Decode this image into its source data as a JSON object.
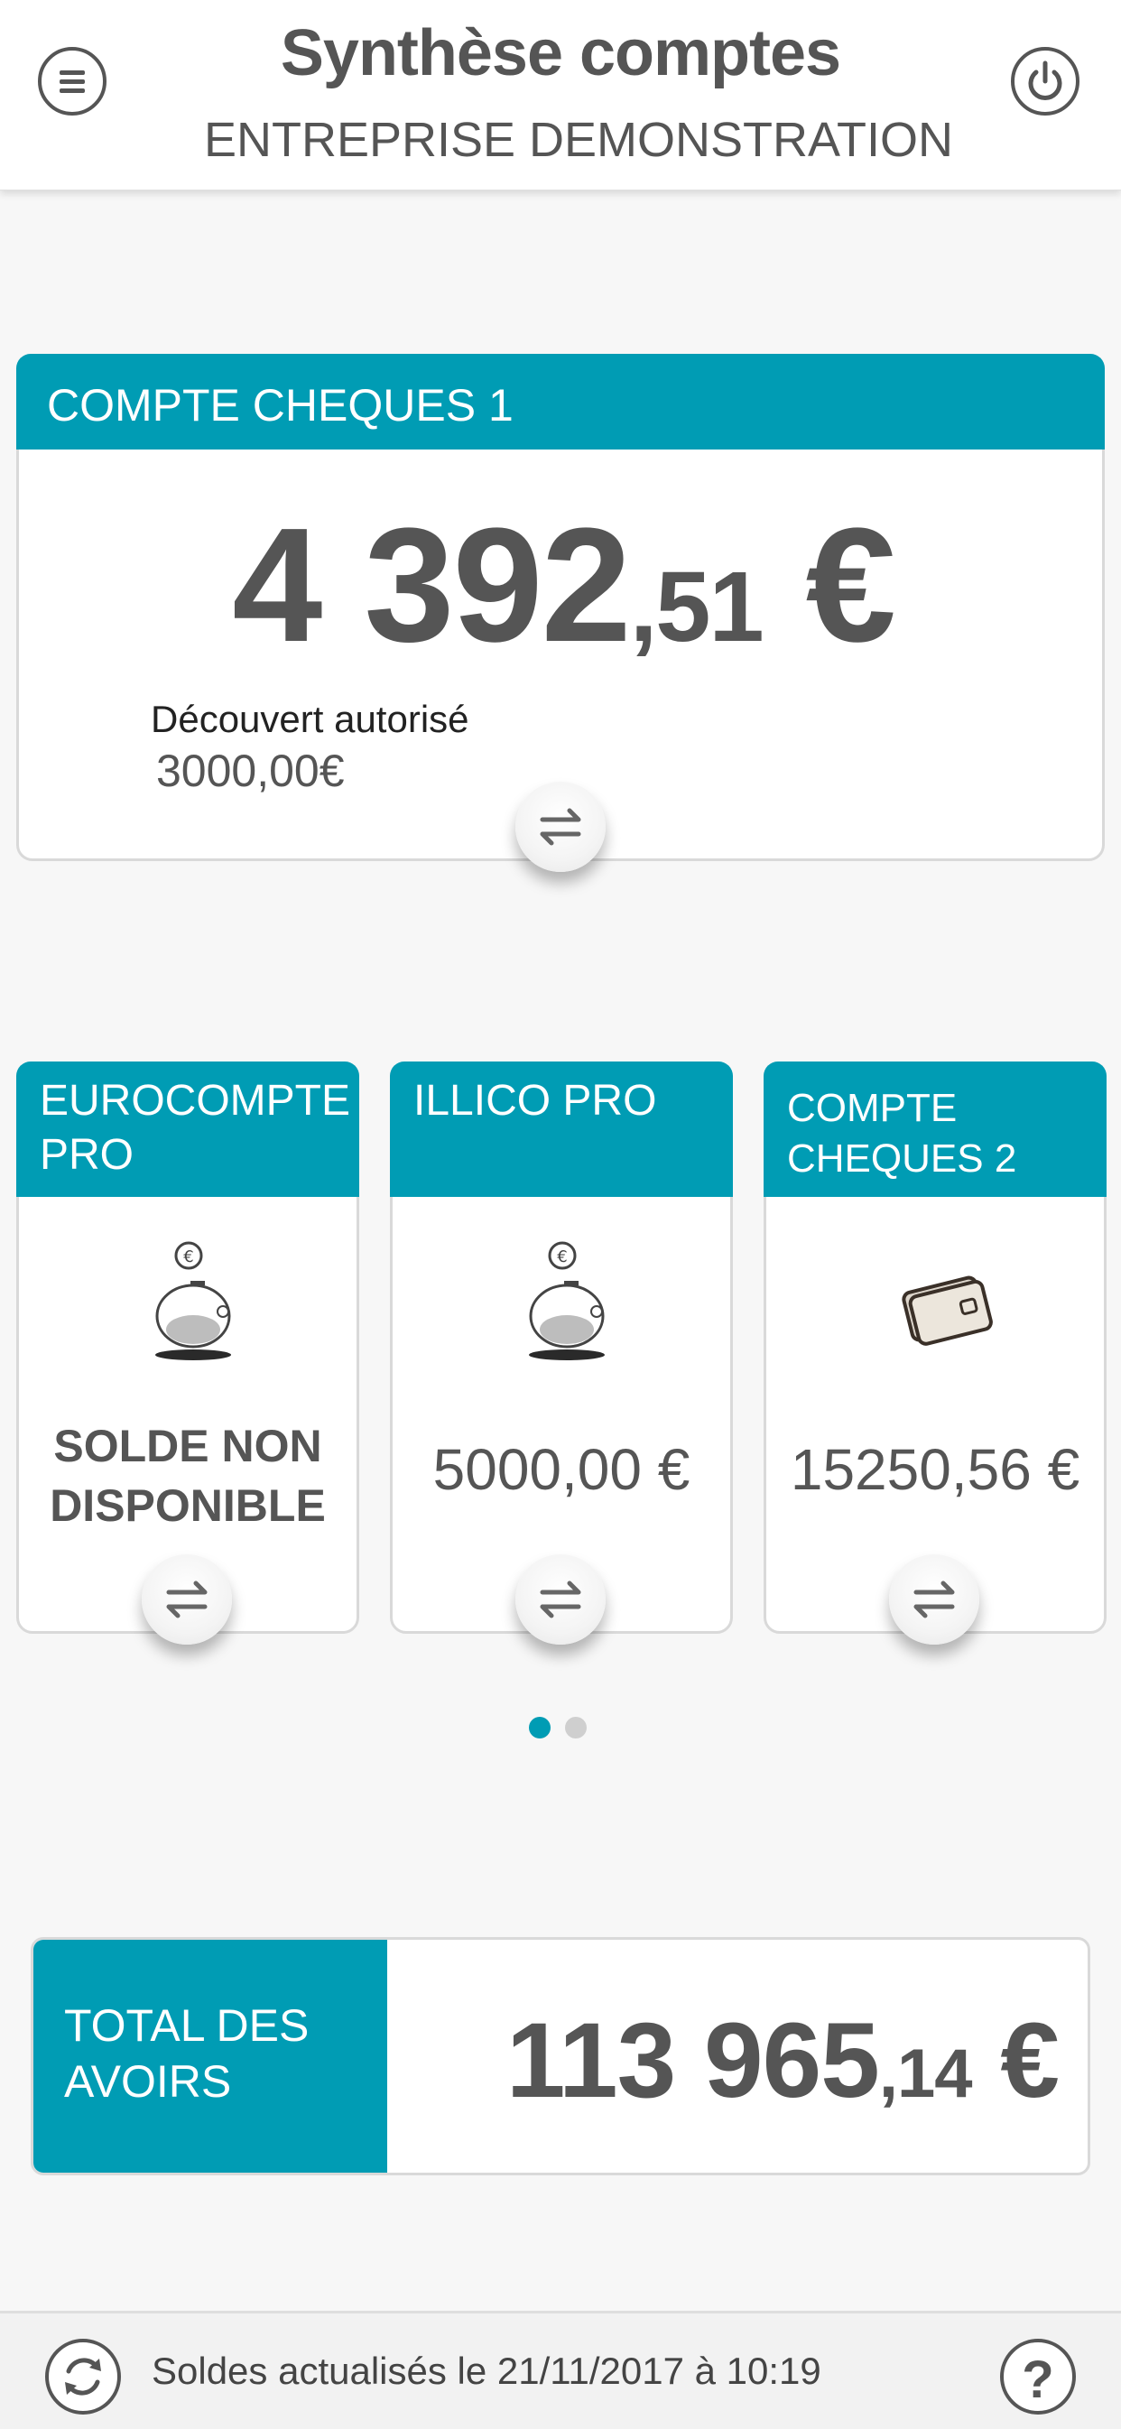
{
  "header": {
    "title": "Synthèse comptes",
    "subtitle": "ENTREPRISE DEMONSTRATION",
    "menu_icon": "hamburger-menu-icon",
    "power_icon": "power-icon"
  },
  "main_account": {
    "name": "COMPTE CHEQUES 1",
    "amount_int": "4 392",
    "amount_dec": ",51",
    "currency": " €",
    "overdraft_label": "Découvert autorisé",
    "overdraft_value": "3000,00€",
    "transfer_icon": "transfer-arrows-icon"
  },
  "accounts": [
    {
      "name": "EUROCOMPTE PRO",
      "icon": "piggy-bank-icon",
      "value": "SOLDE NON DISPONIBLE"
    },
    {
      "name": "ILLICO PRO",
      "icon": "piggy-bank-icon",
      "value": "5000,00 €"
    },
    {
      "name": "COMPTE CHEQUES 2",
      "icon": "card-icon",
      "value": "15250,56 €"
    }
  ],
  "pagination": {
    "pages": 2,
    "current": 1
  },
  "total": {
    "label": "TOTAL DES AVOIRS",
    "amount_int": "113 965",
    "amount_dec": ",14",
    "currency": " €"
  },
  "footer": {
    "text": "Soldes actualisés le 21/11/2017 à 10:19",
    "refresh_icon": "refresh-icon",
    "help_label": "?"
  },
  "colors": {
    "accent": "#009cb4",
    "text": "#555555",
    "background": "#f7f7f7"
  }
}
